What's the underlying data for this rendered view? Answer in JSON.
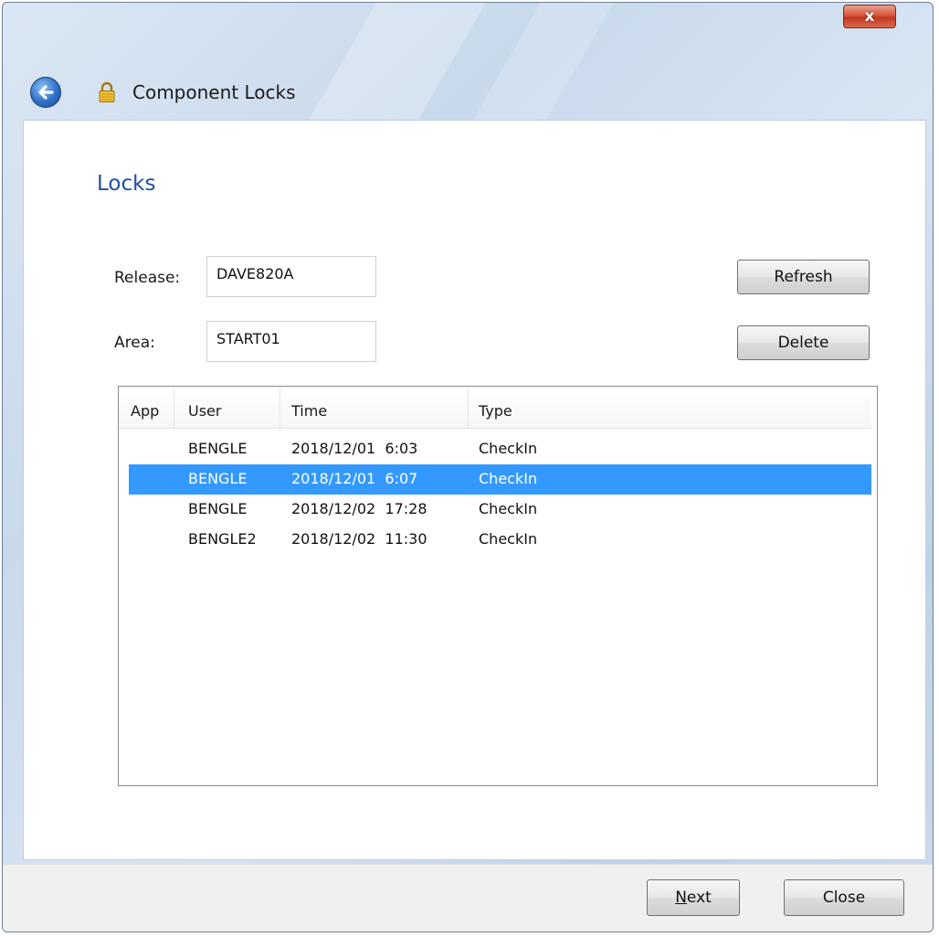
{
  "window": {
    "title": "Component Locks",
    "close_label": "x"
  },
  "page": {
    "heading": "Locks"
  },
  "form": {
    "release_label": "Release:",
    "release_value": "DAVE820A",
    "area_label": "Area:",
    "area_value": "START01"
  },
  "buttons": {
    "refresh": "Refresh",
    "delete": "Delete",
    "next_mnemonic": "N",
    "next_rest": "ext",
    "close": "Close"
  },
  "table": {
    "columns": [
      "App",
      "User",
      "Time",
      "Type"
    ],
    "rows": [
      {
        "app": "",
        "user": "BENGLE",
        "time": "2018/12/01  6:03",
        "type": "CheckIn"
      },
      {
        "app": "",
        "user": "BENGLE",
        "time": "2018/12/01  6:07",
        "type": "CheckIn"
      },
      {
        "app": "",
        "user": "BENGLE",
        "time": "2018/12/02  17:28",
        "type": "CheckIn"
      },
      {
        "app": "",
        "user": "BENGLE2",
        "time": "2018/12/02  11:30",
        "type": "CheckIn"
      }
    ],
    "selected_row": 1
  },
  "icons": {
    "back": "back-arrow-icon",
    "lock": "padlock-icon",
    "close": "close-icon"
  },
  "colors": {
    "heading": "#1f4fa3",
    "selection": "#3399ff",
    "close_button": "#c13a22"
  }
}
